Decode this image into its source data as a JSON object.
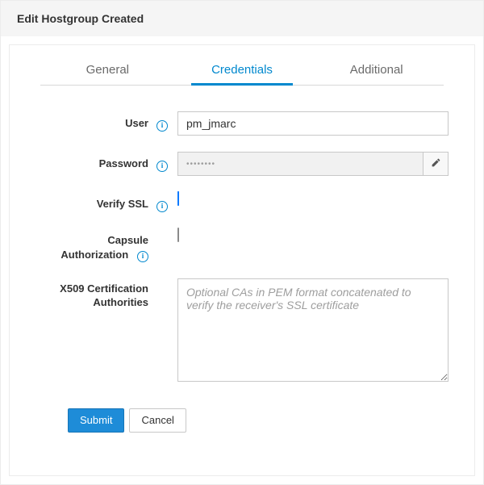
{
  "header": {
    "title": "Edit Hostgroup Created"
  },
  "tabs": {
    "general": {
      "label": "General",
      "active": false
    },
    "credentials": {
      "label": "Credentials",
      "active": true
    },
    "additional": {
      "label": "Additional",
      "active": false
    }
  },
  "form": {
    "user": {
      "label": "User",
      "value": "pm_jmarc",
      "has_info": true
    },
    "password": {
      "label": "Password",
      "masked_value": "••••••••",
      "has_info": true
    },
    "verify_ssl": {
      "label": "Verify SSL",
      "checked": true,
      "has_info": true
    },
    "capsule_authorization": {
      "label_line1": "Capsule",
      "label_line2": "Authorization",
      "checked": false,
      "has_info": true,
      "info_below": true
    },
    "x509": {
      "label_line1": "X509 Certification",
      "label_line2": "Authorities",
      "value": "",
      "placeholder": "Optional CAs in PEM format concatenated to verify the receiver's SSL certificate",
      "has_info": false
    }
  },
  "actions": {
    "submit": "Submit",
    "cancel": "Cancel"
  },
  "icons": {
    "info_glyph": "i"
  }
}
